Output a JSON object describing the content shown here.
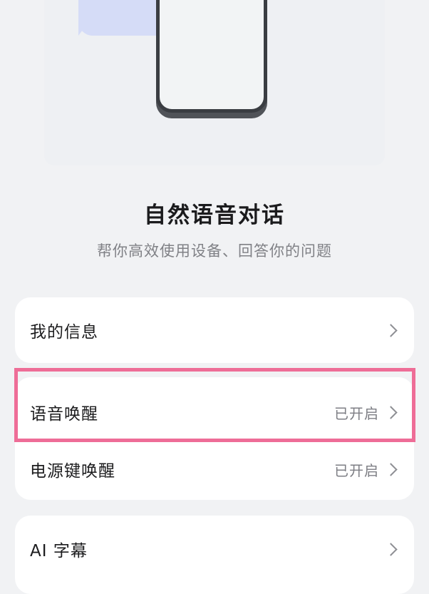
{
  "header": {
    "title": "自然语音对话",
    "subtitle": "帮你高效使用设备、回答你的问题"
  },
  "card1": {
    "items": [
      {
        "label": "我的信息",
        "status": ""
      }
    ]
  },
  "card2": {
    "items": [
      {
        "label": "语音唤醒",
        "status": "已开启"
      },
      {
        "label": "电源键唤醒",
        "status": "已开启"
      }
    ]
  },
  "card3": {
    "items": [
      {
        "label": "AI 字幕",
        "status": ""
      }
    ]
  },
  "colors": {
    "background": "#f1f2f4",
    "card": "#ffffff",
    "highlight_border": "#ee6d97",
    "bubble": "#d5dcf7"
  }
}
